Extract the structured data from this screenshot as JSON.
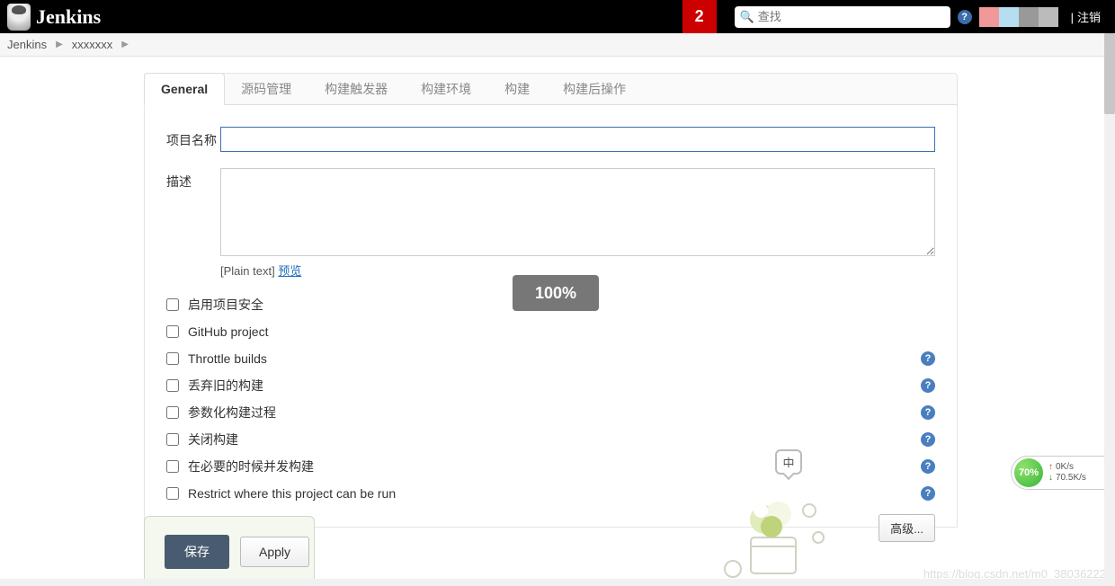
{
  "header": {
    "brand": "Jenkins",
    "notification_count": "2",
    "search_placeholder": "查找",
    "logout_label": "注销"
  },
  "breadcrumb": {
    "items": [
      "Jenkins",
      "xxxxxxx"
    ]
  },
  "tabs": [
    {
      "label": "General",
      "active": true
    },
    {
      "label": "源码管理"
    },
    {
      "label": "构建触发器"
    },
    {
      "label": "构建环境"
    },
    {
      "label": "构建"
    },
    {
      "label": "构建后操作"
    }
  ],
  "form": {
    "project_name_label": "项目名称",
    "project_name_value": "",
    "description_label": "描述",
    "description_value": "",
    "plain_text_hint": "[Plain text]",
    "preview_link": "预览"
  },
  "checkboxes": [
    {
      "label": "启用项目安全",
      "help": false
    },
    {
      "label": "GitHub project",
      "help": false
    },
    {
      "label": "Throttle builds",
      "help": true
    },
    {
      "label": "丢弃旧的构建",
      "help": true
    },
    {
      "label": "参数化构建过程",
      "help": true
    },
    {
      "label": "关闭构建",
      "help": true
    },
    {
      "label": "在必要的时候并发构建",
      "help": true
    },
    {
      "label": "Restrict where this project can be run",
      "help": true
    }
  ],
  "advanced_button": "高级...",
  "actions": {
    "save": "保存",
    "apply": "Apply"
  },
  "overlays": {
    "progress_pct": "100%",
    "ime": "中",
    "net_pct": "70%",
    "net_up": "0K/s",
    "net_down": "70.5K/s",
    "watermark": "https://blog.csdn.net/m0_38036222"
  }
}
